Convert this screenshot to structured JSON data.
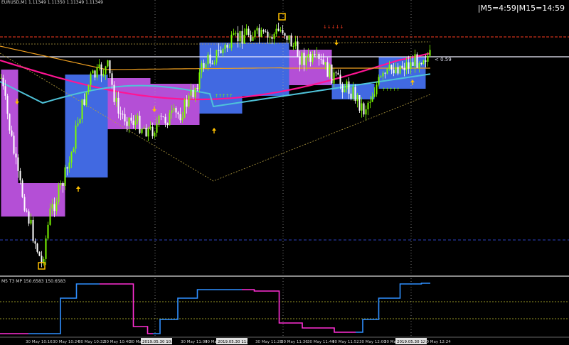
{
  "header": {
    "symbol_line": "EURUSD,M1  1.11349 1.11350 1.11349 1.11349",
    "timer": "|M5=4:59|M15=14:59"
  },
  "indicator": {
    "title": "M5 T3 MP 150.6583 150.6583"
  },
  "price_label": "< 0.59",
  "colors": {
    "background": "#000000",
    "bull_candle": "#7cfc00",
    "bear_candle": "#ffffff",
    "box_blue": "#4169e1",
    "box_magenta": "#b44fd6",
    "ma_pink": "#ff1493",
    "ma_cyan": "#4fc3d9",
    "ma_orange": "#f0a020",
    "envelope": "#b8a040",
    "red_level": "#ff3b1f",
    "white_level": "#f0f0ff",
    "blue_dashed": "#2a3fbf",
    "t3_up": "#2f8fff",
    "t3_down": "#ff2fd6",
    "level_dashed": "#c8c832",
    "arrow": "#ffc000"
  },
  "chart_data": {
    "type": "candlestick",
    "title": "EURUSD,M1",
    "x_labels": [
      "30 May 10:16",
      "30 May 10:24",
      "30 May 10:32",
      "30 May 10:40",
      "30 May 10:48",
      "2019.05.30 10:59",
      "30 May 11:04",
      "30 May 11:12",
      "2019.05.30 11:20",
      "30 May 11:28",
      "30 May 11:36",
      "30 May 11:44",
      "30 May 11:52",
      "30 May 12:00",
      "30 May 12:08",
      "2019.05.30 12:16",
      "30 May 12:24"
    ],
    "timeframe_boxes": [
      {
        "color": "magenta",
        "from": 0,
        "to": 8
      },
      {
        "color": "magenta",
        "from": 8,
        "to": 30
      },
      {
        "color": "blue",
        "from": 30,
        "to": 50
      },
      {
        "color": "magenta",
        "from": 50,
        "to": 70
      },
      {
        "color": "magenta",
        "from": 70,
        "to": 93
      },
      {
        "color": "blue",
        "from": 93,
        "to": 113
      },
      {
        "color": "blue",
        "from": 113,
        "to": 135
      },
      {
        "color": "magenta",
        "from": 135,
        "to": 155
      },
      {
        "color": "blue",
        "from": 155,
        "to": 175
      },
      {
        "color": "blue",
        "from": 177,
        "to": 199
      }
    ],
    "indicator_series": [
      {
        "name": "T3 up",
        "color": "blue"
      },
      {
        "name": "T3 down",
        "color": "magenta"
      }
    ],
    "grid": false
  }
}
